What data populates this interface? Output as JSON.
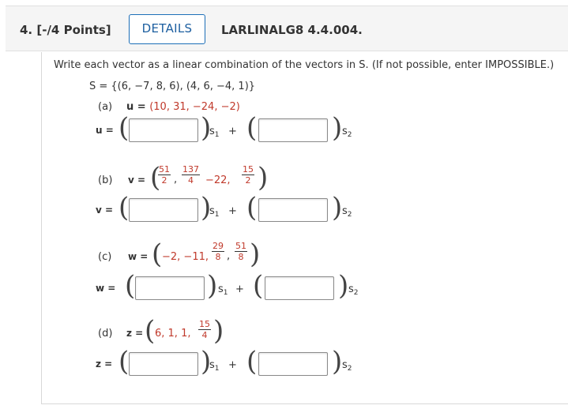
{
  "header": {
    "question_number": "4.",
    "points": "[-/4 Points]",
    "details_label": "DETAILS",
    "problem_code": "LARLINALG8 4.4.004."
  },
  "instructions": "Write each vector as a linear combination of the vectors in S. (If not possible, enter IMPOSSIBLE.)",
  "set_S": "S = {(6, −7, 8, 6), (4, 6, −4, 1)}",
  "parts": {
    "a": {
      "label": "(a)",
      "vector_name": "u",
      "vector_prefix": "u = ",
      "vector_values": "(10, 31, −24, −2)",
      "answer_label": "u ="
    },
    "b": {
      "label": "(b)",
      "vector_name": "v",
      "vector_prefix": "v =",
      "f1_num": "51",
      "f1_den": "2",
      "f2_num": "137",
      "f2_den": "4",
      "middle": "−22,",
      "f3_num": "15",
      "f3_den": "2",
      "answer_label": "v ="
    },
    "c": {
      "label": "(c)",
      "vector_name": "w",
      "vector_prefix": "w =",
      "values_text": "−2, −11,",
      "f1_num": "29",
      "f1_den": "8",
      "f2_num": "51",
      "f2_den": "8",
      "answer_label": "w ="
    },
    "d": {
      "label": "(d)",
      "vector_name": "z",
      "vector_prefix": "z =",
      "values_text": "6, 1, 1,",
      "f1_num": "15",
      "f1_den": "4",
      "answer_label": "z ="
    }
  },
  "basis": {
    "s1_base": "s",
    "s1_sub": "1",
    "s2_base": "s",
    "s2_sub": "2",
    "plus": "+"
  },
  "answers": {
    "a1": "",
    "a2": "",
    "b1": "",
    "b2": "",
    "c1": "",
    "c2": "",
    "d1": "",
    "d2": ""
  }
}
